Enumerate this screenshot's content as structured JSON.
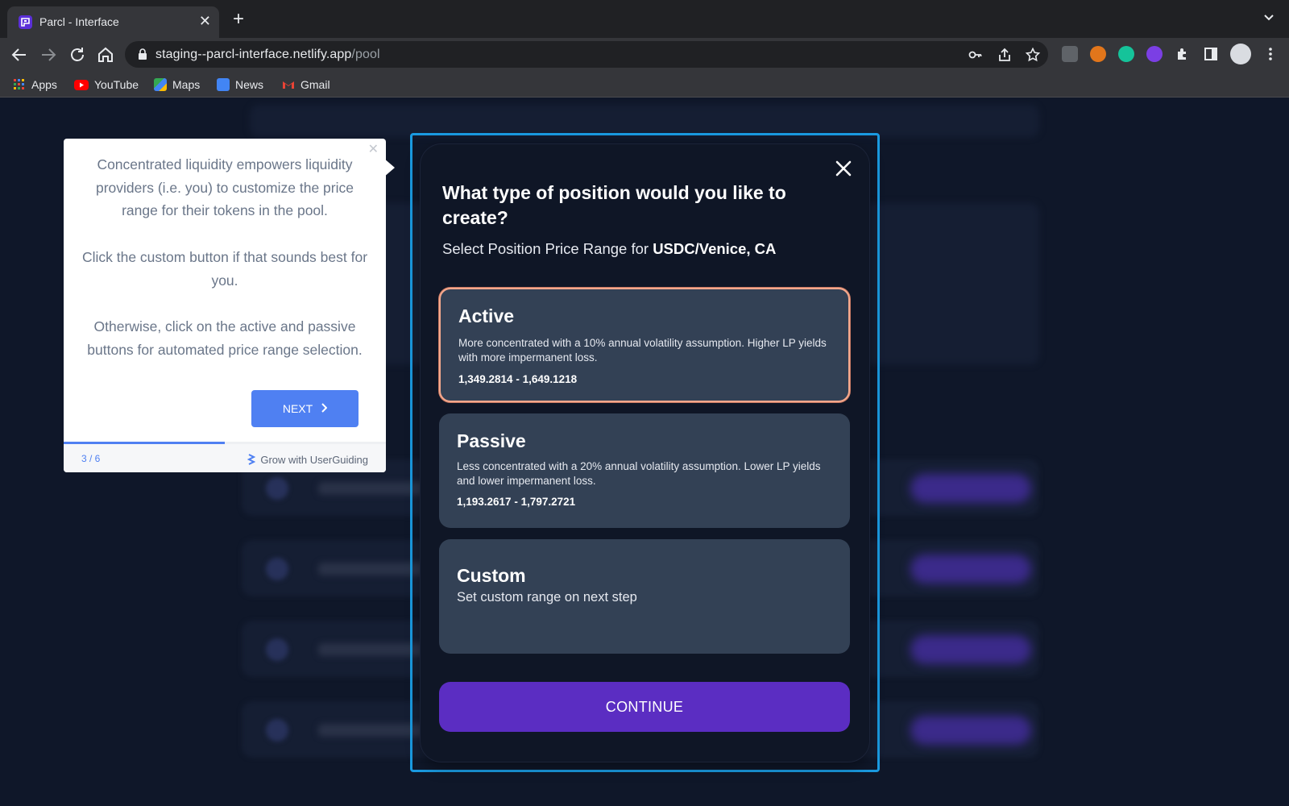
{
  "browser": {
    "tab_title": "Parcl - Interface",
    "url_host": "staging--parcl-interface.netlify.app",
    "url_path": "/pool",
    "bookmarks": [
      "Apps",
      "YouTube",
      "Maps",
      "News",
      "Gmail"
    ]
  },
  "guide": {
    "paragraphs": [
      "Concentrated liquidity empowers liquidity providers (i.e. you) to customize the price range for their tokens in the pool.",
      "Click the custom button if that sounds best for you.",
      "Otherwise, click on the active and passive buttons for automated price range selection."
    ],
    "next_label": "NEXT",
    "step": "3 / 6",
    "progress": 0.5,
    "brand": "Grow with UserGuiding"
  },
  "modal": {
    "title": "What type of position would you like to create?",
    "subtitle_prefix": "Select Position Price Range for ",
    "pair": "USDC/Venice, CA",
    "options": [
      {
        "name": "Active",
        "description": "More concentrated with a 10% annual volatility assumption. Higher LP yields with more impermanent loss.",
        "range": "1,349.2814 - 1,649.1218",
        "selected": true
      },
      {
        "name": "Passive",
        "description": "Less concentrated with a 20% annual volatility assumption. Lower LP yields and lower impermanent loss.",
        "range": "1,193.2617 - 1,797.2721",
        "selected": false
      },
      {
        "name": "Custom",
        "description": "Set custom range on next step",
        "selected": false
      }
    ],
    "continue_label": "CONTINUE"
  },
  "colors": {
    "accent_purple": "#5b2dc2",
    "highlight_blue": "#1a9ae0",
    "selected_border": "#f5a98d",
    "guide_blue": "#4f80f2"
  }
}
